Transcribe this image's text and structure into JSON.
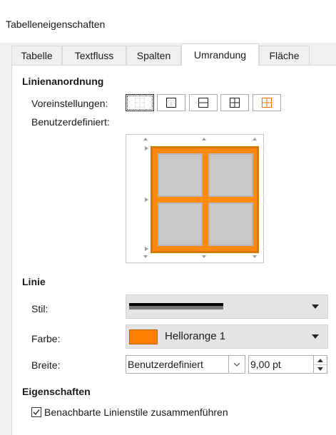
{
  "window": {
    "title": "Tabelleneigenschaften"
  },
  "tabs": [
    {
      "label": "Tabelle",
      "active": false
    },
    {
      "label": "Textfluss",
      "active": false
    },
    {
      "label": "Spalten",
      "active": false
    },
    {
      "label": "Umrandung",
      "active": true
    },
    {
      "label": "Fläche",
      "active": false
    }
  ],
  "line_arrangement": {
    "heading": "Linienanordnung",
    "presets_label": "Voreinstellungen:",
    "presets": [
      {
        "icon": "no-borders-icon",
        "selected": true
      },
      {
        "icon": "outer-border-icon",
        "selected": false
      },
      {
        "icon": "outer-border-horizontal-icon",
        "selected": false
      },
      {
        "icon": "outer-border-all-inner-icon",
        "selected": false
      },
      {
        "icon": "outer-border-keep-inner-icon",
        "selected": false
      }
    ],
    "custom_label": "Benutzerdefiniert:"
  },
  "line": {
    "heading": "Linie",
    "style_label": "Stil:",
    "color_label": "Farbe:",
    "color_value": "Hellorange 1",
    "color_hex": "#ff8000",
    "width_label": "Breite:",
    "width_mode": "Benutzerdefiniert",
    "width_value": "9,00 pt"
  },
  "properties": {
    "heading": "Eigenschaften",
    "merge_label": "Benachbarte Linienstile zusammenführen",
    "merge_checked": true
  }
}
